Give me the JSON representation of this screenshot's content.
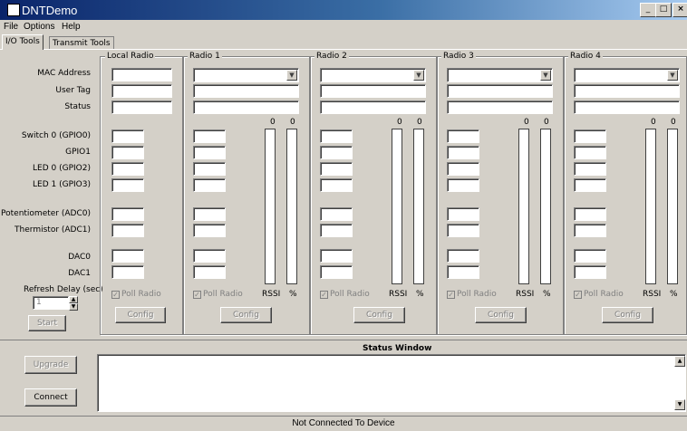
{
  "window": {
    "title": "DNTDemo",
    "minimize": "_",
    "maximize": "□",
    "close": "×"
  },
  "menu": {
    "file": "File",
    "options": "Options",
    "help": "Help"
  },
  "tabs": [
    {
      "label": "I/O Tools"
    },
    {
      "label": "Transmit Tools"
    }
  ],
  "labels": {
    "mac": "MAC Address",
    "user_tag": "User Tag",
    "status": "Status",
    "switch0": "Switch 0 (GPIO0)",
    "gpio1": "GPIO1",
    "led0": "LED 0 (GPIO2)",
    "led1": "LED 1 (GPIO3)",
    "pot": "Potentiometer (ADC0)",
    "therm": "Thermistor (ADC1)",
    "dac0": "DAC0",
    "dac1": "DAC1",
    "refresh": "Refresh Delay (sec)"
  },
  "refresh_value": "1",
  "start_label": "Start",
  "local_radio": {
    "title": "Local Radio",
    "poll_label": "Poll Radio",
    "config_label": "Config"
  },
  "radios": [
    {
      "title": "Radio 1",
      "rssi_value": "0",
      "pct_value": "0",
      "poll_label": "Poll Radio",
      "rssi_label": "RSSI",
      "pct_label": "%",
      "config_label": "Config"
    },
    {
      "title": "Radio 2",
      "rssi_value": "0",
      "pct_value": "0",
      "poll_label": "Poll Radio",
      "rssi_label": "RSSI",
      "pct_label": "%",
      "config_label": "Config"
    },
    {
      "title": "Radio 3",
      "rssi_value": "0",
      "pct_value": "0",
      "poll_label": "Poll Radio",
      "rssi_label": "RSSI",
      "pct_label": "%",
      "config_label": "Config"
    },
    {
      "title": "Radio 4",
      "rssi_value": "0",
      "pct_value": "0",
      "poll_label": "Poll Radio",
      "rssi_label": "RSSI",
      "pct_label": "%",
      "config_label": "Config"
    }
  ],
  "status_window": {
    "title": "Status Window",
    "content": ""
  },
  "upgrade_label": "Upgrade",
  "connect_label": "Connect",
  "statusbar": {
    "text": "Not Connected To Device"
  }
}
